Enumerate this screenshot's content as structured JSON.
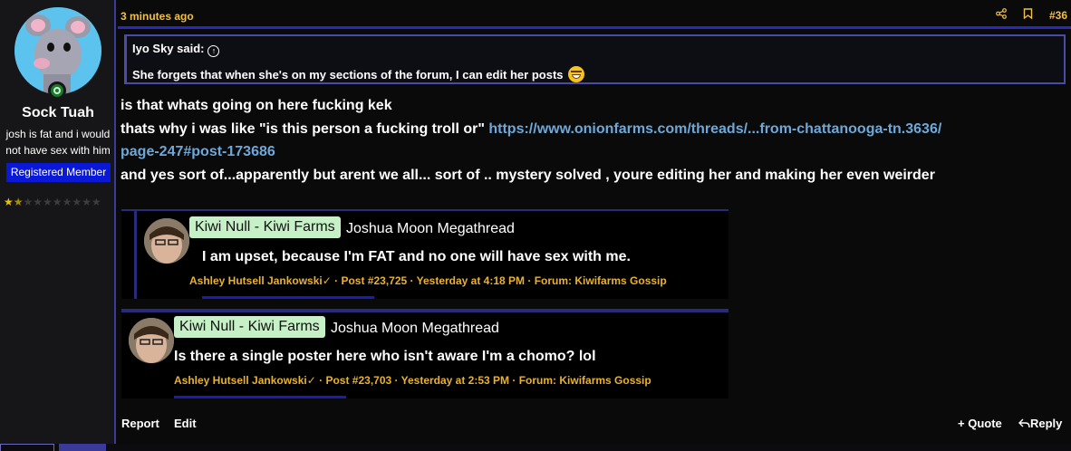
{
  "user": {
    "username": "Sock Tuah",
    "title": "josh is fat and i would not have sex with him",
    "badge": "Registered Member",
    "rating": 1.5,
    "rating_max": 10
  },
  "post": {
    "time": "3 minutes ago",
    "number": "#36",
    "quote": {
      "author": "Iyo Sky said:",
      "text": "She forgets that when she's on my sections of the forum, I can edit her posts"
    },
    "lines": [
      "is that whats going on here fucking kek",
      "thats why i was like \"is this person a fucking troll or\" ",
      "and yes sort of...apparently but arent we all... sort of .. mystery solved , youre editing her and making her even weirder"
    ],
    "link_text_1": "https://www.onionfarms.com/threads/...from-chattanooga-tn.3636/",
    "link_text_2": "page-247#post-173686",
    "embeds": [
      {
        "source": "Kiwi Null - Kiwi Farms",
        "thread": "Joshua Moon Megathread",
        "text": "I am upset, because I'm FAT and no one will have sex with me.",
        "author": "Ashley Hutsell Jankowski",
        "meta": "· Post #23,725 · Yesterday at 4:18 PM · Forum: Kiwifarms Gossip"
      },
      {
        "source": "Kiwi Null - Kiwi Farms",
        "thread": "Joshua Moon Megathread",
        "text": "Is there a single poster here who isn't aware I'm a chomo? lol",
        "author": "Ashley Hutsell Jankowski",
        "meta": "· Post #23,703 · Yesterday at 2:53 PM · Forum: Kiwifarms Gossip"
      }
    ],
    "footer": {
      "report": "Report",
      "edit": "Edit",
      "quote": "Quote",
      "reply": "Reply"
    }
  },
  "colors": {
    "accent_gold": "#f0c048",
    "link": "#6fa8d8",
    "badge_blue": "#0a18d8",
    "border_blue": "#2a2ab8",
    "tag_green": "#c6f1c6"
  },
  "icons": [
    "share-icon",
    "bookmark-icon",
    "quote-plus-icon",
    "reply-icon",
    "online-icon",
    "verified-icon"
  ]
}
